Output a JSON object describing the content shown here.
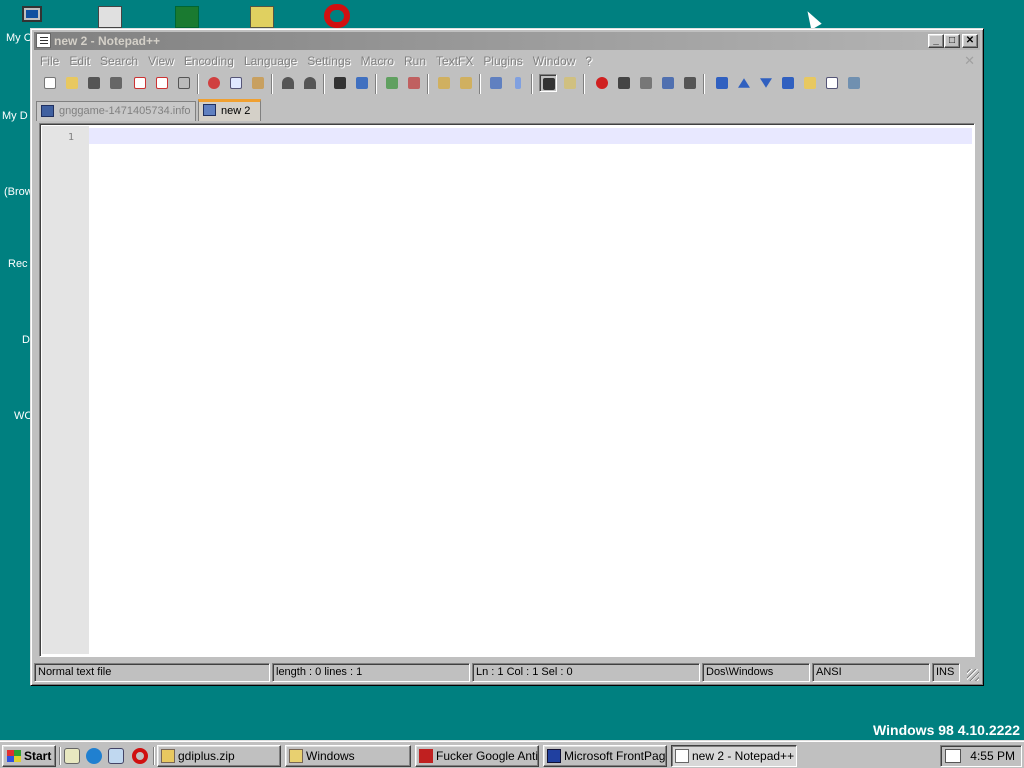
{
  "desktop": {
    "icons": [
      {
        "label": "My C",
        "name": "my-computer-icon"
      },
      {
        "label": "My D",
        "name": "my-documents-icon"
      },
      {
        "label": "(Brow",
        "name": "browser-icon"
      },
      {
        "label": "Rec",
        "name": "recycle-bin-icon"
      },
      {
        "label": "D",
        "name": "shortcut-d-icon"
      },
      {
        "label": "WC",
        "name": "shortcut-wc-icon"
      }
    ],
    "version_text": "Windows 98 4.10.2222"
  },
  "window": {
    "title": "new  2 - Notepad++",
    "controls": {
      "minimize": "_",
      "maximize": "□",
      "close": "✕"
    }
  },
  "menubar": {
    "items": [
      "File",
      "Edit",
      "Search",
      "View",
      "Encoding",
      "Language",
      "Settings",
      "Macro",
      "Run",
      "TextFX",
      "Plugins",
      "Window",
      "?"
    ],
    "close_glyph": "✕"
  },
  "tabs": [
    {
      "label": "gnggame-1471405734.info",
      "active": false
    },
    {
      "label": "new  2",
      "active": true
    }
  ],
  "editor": {
    "line_numbers": [
      "1"
    ],
    "content": ""
  },
  "statusbar": {
    "file_type": "Normal text file",
    "length_lines": "length : 0    lines : 1",
    "position": "Ln : 1    Col : 1    Sel : 0",
    "eol": "Dos\\Windows",
    "encoding": "ANSI",
    "mode": "INS"
  },
  "taskbar": {
    "start_label": "Start",
    "tasks": [
      {
        "label": "gdiplus.zip",
        "name": "task-gdiplus-zip"
      },
      {
        "label": "Windows",
        "name": "task-windows-folder"
      },
      {
        "label": "Fucker Google Anti...",
        "name": "task-fucker-google"
      },
      {
        "label": "Microsoft FrontPage",
        "name": "task-frontpage"
      },
      {
        "label": "new  2 - Notepad++",
        "name": "task-notepadpp"
      }
    ],
    "clock": "4:55 PM"
  },
  "colors": {
    "desktop": "#008080",
    "tab_accent": "#f0a030",
    "current_line": "#e8e8ff"
  }
}
